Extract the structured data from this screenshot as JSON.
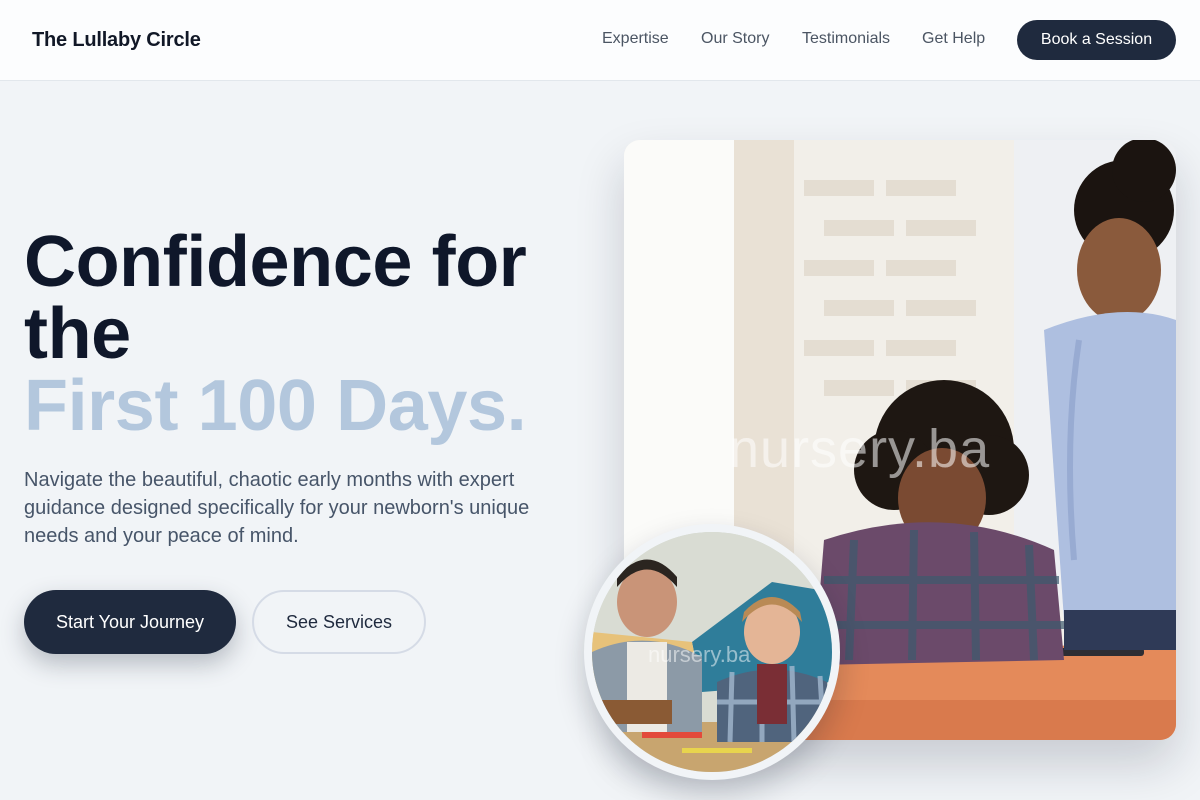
{
  "header": {
    "brand": "The Lullaby Circle",
    "nav": [
      "Expertise",
      "Our Story",
      "Testimonials",
      "Get Help"
    ],
    "cta": "Book a Session"
  },
  "hero": {
    "headline_line1": "Confidence for",
    "headline_line2": "the",
    "headline_accent": "First 100 Days.",
    "subcopy": "Navigate the beautiful, chaotic early months with expert guidance designed specifically for your newborn's unique needs and your peace of mind.",
    "primary_button": "Start Your Journey",
    "secondary_button": "See Services"
  },
  "images": {
    "main_watermark": "nursery.ba",
    "circle_watermark": "nursery.ba"
  },
  "colors": {
    "accent": "#b3c7dd",
    "button_dark": "#1f2a3e",
    "background": "#f1f4f7"
  }
}
